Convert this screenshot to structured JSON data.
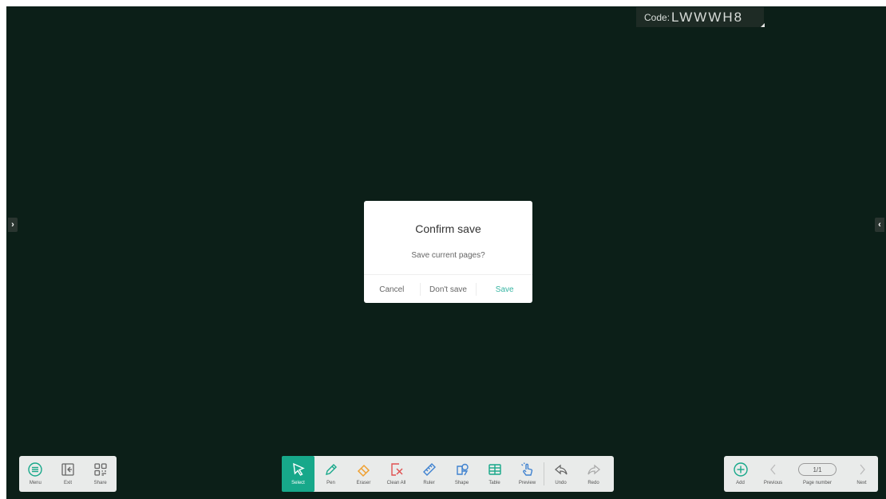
{
  "session": {
    "code_label": "Code:",
    "code_value": "LWWWH8"
  },
  "side_tabs": {
    "left": "›",
    "right": "‹"
  },
  "dialog": {
    "title": "Confirm save",
    "message": "Save current pages?",
    "cancel": "Cancel",
    "dont_save": "Don't save",
    "save": "Save"
  },
  "left_toolbar": [
    {
      "label": "Menu",
      "icon": "menu-icon"
    },
    {
      "label": "Exit",
      "icon": "exit-icon"
    },
    {
      "label": "Share",
      "icon": "qr-share-icon"
    }
  ],
  "center_toolbar": [
    {
      "label": "Select",
      "icon": "select-arrow-icon",
      "active": true
    },
    {
      "label": "Pen",
      "icon": "pen-icon"
    },
    {
      "label": "Eraser",
      "icon": "eraser-icon"
    },
    {
      "label": "Clean All",
      "icon": "clean-all-icon"
    },
    {
      "label": "Ruler",
      "icon": "ruler-icon"
    },
    {
      "label": "Shape",
      "icon": "shape-icon"
    },
    {
      "label": "Table",
      "icon": "table-icon"
    },
    {
      "label": "Preview",
      "icon": "preview-hand-icon"
    },
    {
      "label": "Undo",
      "icon": "undo-icon"
    },
    {
      "label": "Redo",
      "icon": "redo-icon"
    }
  ],
  "right_toolbar": {
    "add": "Add",
    "previous": "Previous",
    "page_number_label": "Page number",
    "page_value": "1/1",
    "next": "Next"
  },
  "colors": {
    "background": "#0c1f18",
    "accent": "#17a88a",
    "save_text": "#36b4a2",
    "toolbar_bg": "#e9ebea"
  }
}
